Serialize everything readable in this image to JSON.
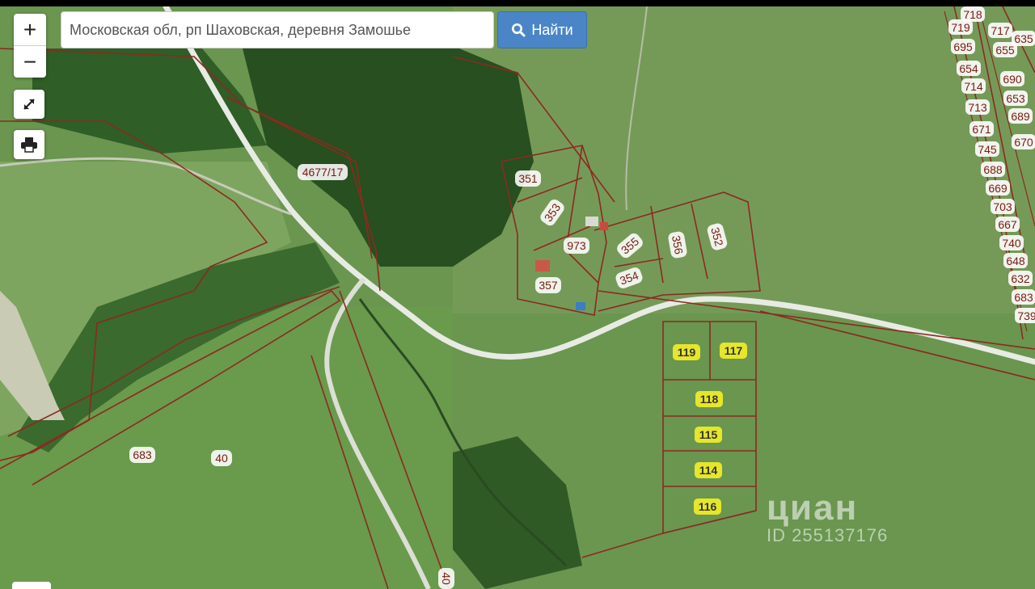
{
  "map": {
    "search": {
      "value": "Московская обл, рп Шаховская, деревня Замошье"
    },
    "find_button": {
      "label": "Найти"
    },
    "controls": {
      "zoom_in": "+",
      "zoom_out": "−"
    },
    "parcels": {
      "p4677_17": "4677/17",
      "p351": "351",
      "p353": "353",
      "p973": "973",
      "p355": "355",
      "p356": "356",
      "p352": "352",
      "p354": "354",
      "p357": "357",
      "p683": "683",
      "p40": "40",
      "p40b": "40"
    },
    "highlighted": {
      "p119": "119",
      "p117": "117",
      "p118": "118",
      "p115": "115",
      "p114": "114",
      "p116": "116"
    },
    "column": [
      "718",
      "719",
      "717",
      "635",
      "695",
      "655",
      "654",
      "690",
      "714",
      "653",
      "713",
      "689",
      "671",
      "745",
      "670",
      "688",
      "669",
      "703",
      "667",
      "740",
      "648",
      "632",
      "683",
      "739"
    ],
    "watermark": {
      "brand": "циан",
      "id": "ID 255137176"
    },
    "colors": {
      "boundary": "#8b2a20",
      "highlight": "#e6e62a",
      "button": "#4a86c7"
    }
  }
}
